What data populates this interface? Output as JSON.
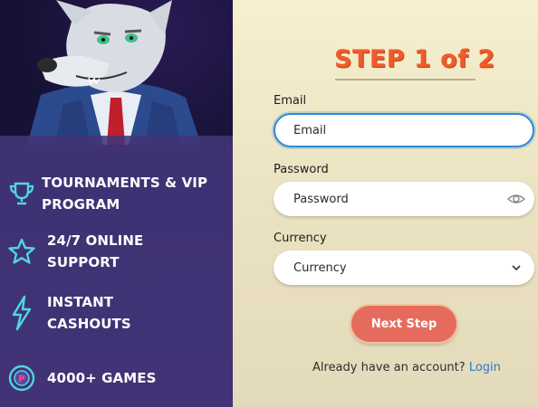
{
  "features": [
    {
      "icon": "trophy-icon",
      "line1": "TOURNAMENTS & VIP",
      "line2": "PROGRAM"
    },
    {
      "icon": "star-icon",
      "line1": "24/7 ONLINE",
      "line2": "SUPPORT"
    },
    {
      "icon": "lightning-icon",
      "line1": "INSTANT",
      "line2": "CASHOUTS"
    },
    {
      "icon": "chip-icon",
      "line1": "4000+ GAMES",
      "line2": ""
    }
  ],
  "step": {
    "title": "STEP 1 of 2"
  },
  "form": {
    "email_label": "Email",
    "email_placeholder": "Email",
    "password_label": "Password",
    "password_placeholder": "Password",
    "currency_label": "Currency",
    "currency_value": "Currency"
  },
  "actions": {
    "next_label": "Next Step",
    "already_text": "Already have an account?",
    "login_label": "Login"
  },
  "colors": {
    "accent_orange": "#ef5b2a",
    "button": "#e56b5e",
    "link": "#2a78c8",
    "icon_cyan": "#4fd6e0",
    "focus_border": "#2e88d8"
  }
}
